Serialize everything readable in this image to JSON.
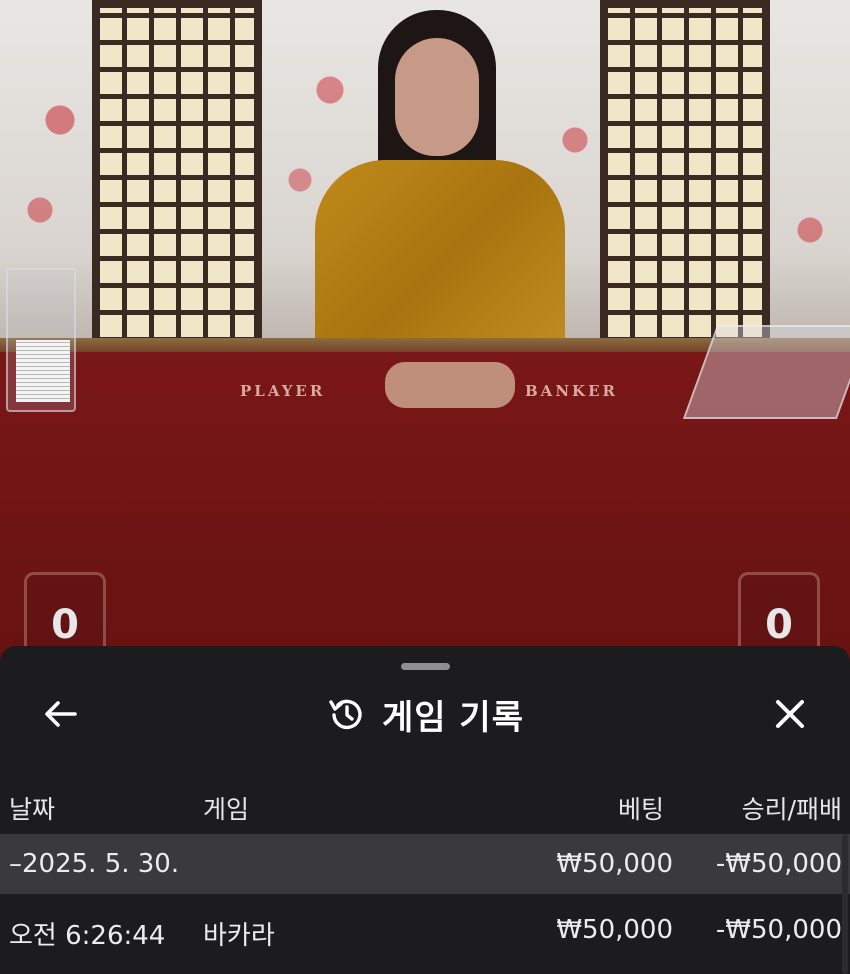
{
  "video": {
    "table_labels": {
      "player": "PLAYER",
      "banker": "BANKER"
    },
    "scores": {
      "player": "0",
      "banker": "0"
    }
  },
  "sheet": {
    "title": "게임 기록",
    "icons": {
      "back": "arrow-left-icon",
      "history": "history-clock-icon",
      "close": "close-x-icon"
    },
    "columns": {
      "date": "날짜",
      "game": "게임",
      "bet": "베팅",
      "win_loss": "승리/패배"
    },
    "date_group": {
      "label": "–2025. 5. 30.",
      "bet": "₩50,000",
      "win_loss": "-₩50,000"
    },
    "rows": [
      {
        "time": "오전 6:26:44",
        "game": "바카라",
        "bet": "₩50,000",
        "win_loss": "-₩50,000"
      }
    ]
  },
  "colors": {
    "sheet_bg": "#1c1c1e",
    "highlight_row": "#3a3a3c",
    "text": "#ffffff",
    "felt": "#6a1313"
  }
}
